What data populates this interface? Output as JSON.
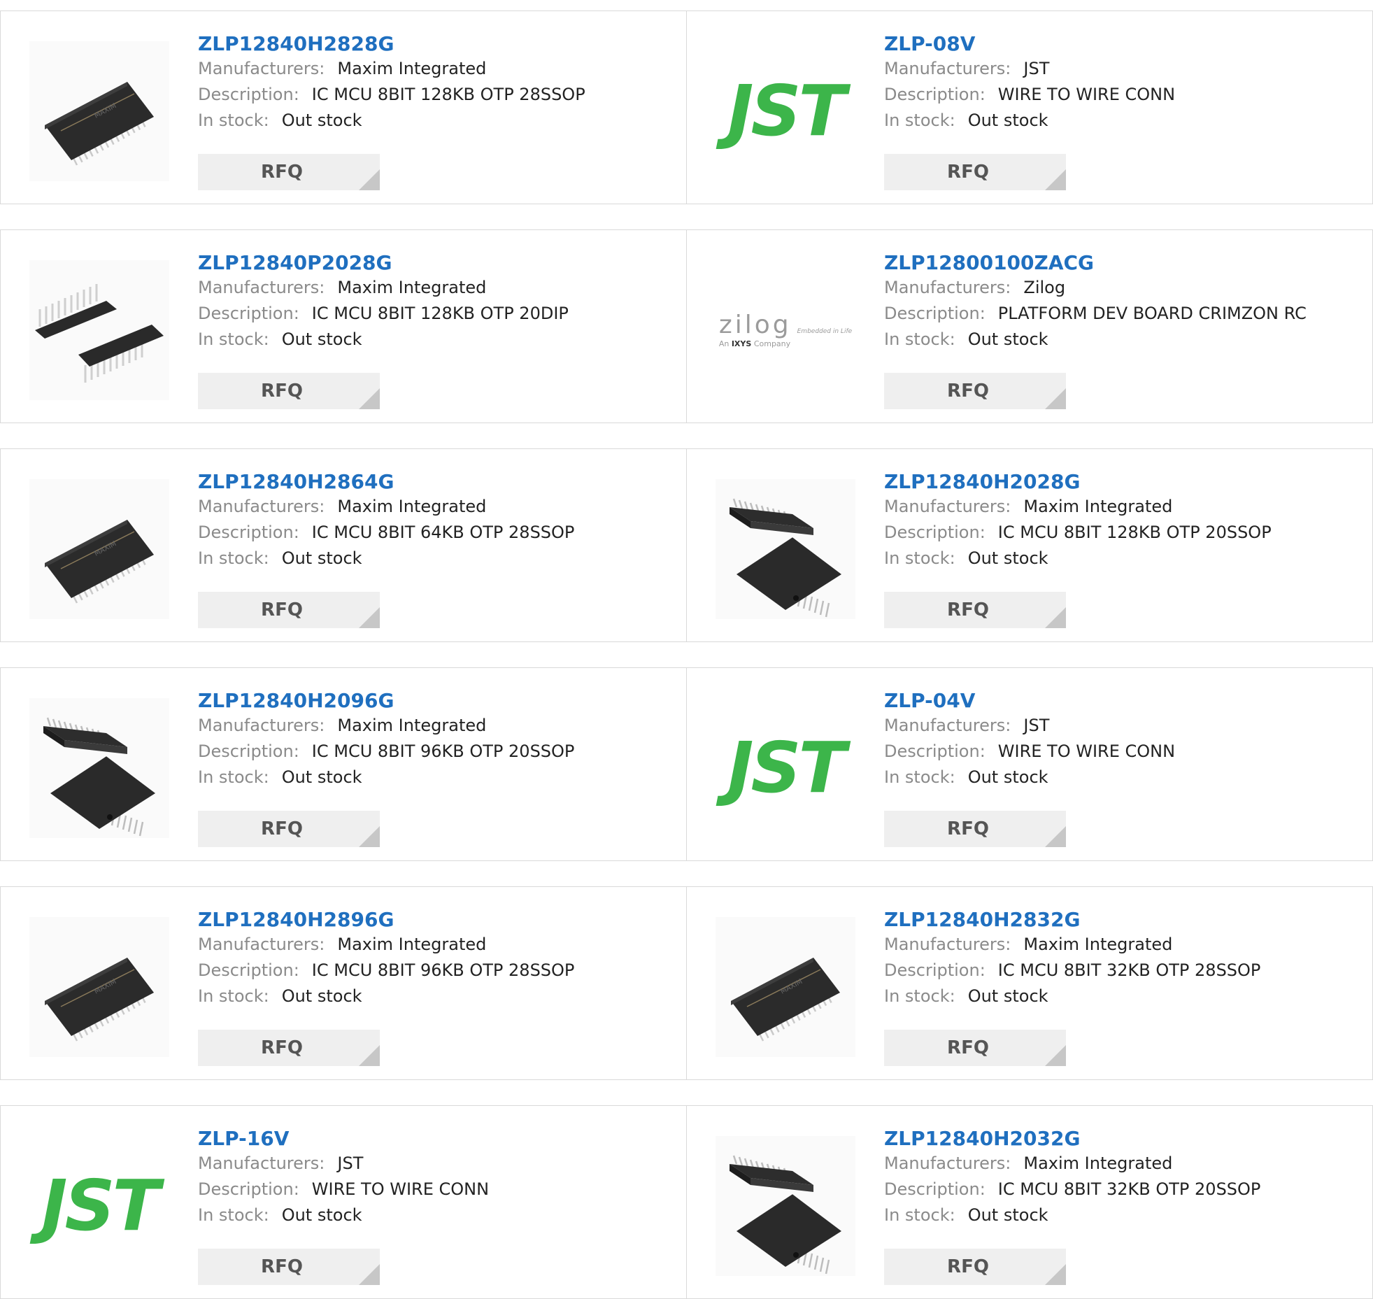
{
  "labels": {
    "manufacturers": "Manufacturers:",
    "description": "Description:",
    "stock": "In stock:",
    "rfq": "RFQ"
  },
  "brand": {
    "jst_text": "JST",
    "jst_color": "#3cb54a",
    "zilog_text": "zilog",
    "zilog_tag": "Embedded in Life",
    "zilog_sub_prefix": "An",
    "zilog_sub_brand": "IXYS",
    "zilog_sub_suffix": "Company"
  },
  "products": [
    {
      "part": "ZLP12840H2828G",
      "manufacturer": "Maxim Integrated",
      "description": "IC MCU 8BIT 128KB OTP 28SSOP",
      "stock": "Out stock",
      "image": "ssop28-chip-icon"
    },
    {
      "part": "ZLP-08V",
      "manufacturer": "JST",
      "description": "WIRE TO WIRE CONN",
      "stock": "Out stock",
      "image": "jst-logo"
    },
    {
      "part": "ZLP12840P2028G",
      "manufacturer": "Maxim Integrated",
      "description": "IC MCU 8BIT 128KB OTP 20DIP",
      "stock": "Out stock",
      "image": "dip20-chip-icon"
    },
    {
      "part": "ZLP12800100ZACG",
      "manufacturer": "Zilog",
      "description": "PLATFORM DEV BOARD CRIMZON RC",
      "stock": "Out stock",
      "image": "zilog-logo"
    },
    {
      "part": "ZLP12840H2864G",
      "manufacturer": "Maxim Integrated",
      "description": "IC MCU 8BIT 64KB OTP 28SSOP",
      "stock": "Out stock",
      "image": "ssop28-chip-icon"
    },
    {
      "part": "ZLP12840H2028G",
      "manufacturer": "Maxim Integrated",
      "description": "IC MCU 8BIT 128KB OTP 20SSOP",
      "stock": "Out stock",
      "image": "ssop20-chip-icon"
    },
    {
      "part": "ZLP12840H2096G",
      "manufacturer": "Maxim Integrated",
      "description": "IC MCU 8BIT 96KB OTP 20SSOP",
      "stock": "Out stock",
      "image": "ssop20-chip-icon"
    },
    {
      "part": "ZLP-04V",
      "manufacturer": "JST",
      "description": "WIRE TO WIRE CONN",
      "stock": "Out stock",
      "image": "jst-logo"
    },
    {
      "part": "ZLP12840H2896G",
      "manufacturer": "Maxim Integrated",
      "description": "IC MCU 8BIT 96KB OTP 28SSOP",
      "stock": "Out stock",
      "image": "ssop28-chip-icon"
    },
    {
      "part": "ZLP12840H2832G",
      "manufacturer": "Maxim Integrated",
      "description": "IC MCU 8BIT 32KB OTP 28SSOP",
      "stock": "Out stock",
      "image": "ssop28-chip-icon"
    },
    {
      "part": "ZLP-16V",
      "manufacturer": "JST",
      "description": "WIRE TO WIRE CONN",
      "stock": "Out stock",
      "image": "jst-logo"
    },
    {
      "part": "ZLP12840H2032G",
      "manufacturer": "Maxim Integrated",
      "description": "IC MCU 8BIT 32KB OTP 20SSOP",
      "stock": "Out stock",
      "image": "ssop20-chip-icon"
    }
  ]
}
